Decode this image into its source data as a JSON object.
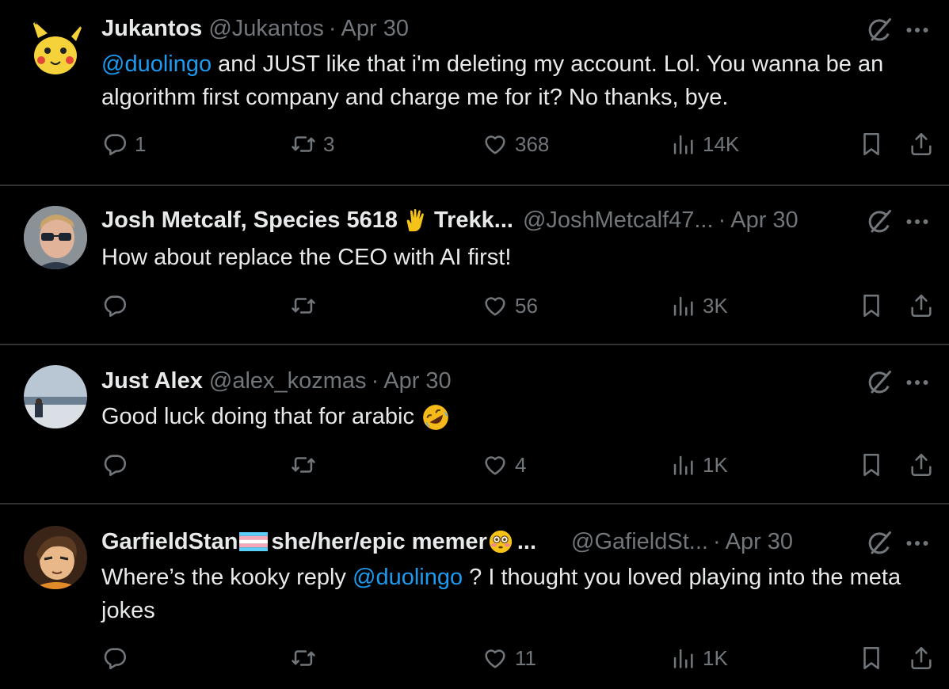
{
  "tweets": [
    {
      "name": "Jukantos",
      "handle": "@Jukantos",
      "separator": "·",
      "date": "Apr 30",
      "text_mention": "@duolingo",
      "text_after": " and JUST like that i'm deleting my account. Lol. You wanna be an algorithm first company and charge me for it? No thanks, bye.",
      "replies": "1",
      "reposts": "3",
      "likes": "368",
      "views": "14K"
    },
    {
      "name": "Josh Metcalf, Species 5618",
      "name_emoji": "vulcan-salute",
      "name_after": "Trekk...",
      "handle": "@JoshMetcalf47...",
      "separator": "·",
      "date": "Apr 30",
      "text": "How about replace the CEO with AI first!",
      "replies": "",
      "reposts": "",
      "likes": "56",
      "views": "3K"
    },
    {
      "name": "Just Alex",
      "handle": "@alex_kozmas",
      "separator": "·",
      "date": "Apr 30",
      "text": "Good luck doing that for arabic",
      "text_emoji": "rolling-on-floor-laughing",
      "replies": "",
      "reposts": "",
      "likes": "4",
      "views": "1K"
    },
    {
      "name": "GarfieldStan",
      "name_flag": "transgender-flag",
      "name_after": "she/her/epic memer",
      "name_emoji": "flushed-face",
      "name_ellipsis": "...",
      "handle": "@GafieldSt...",
      "separator": "·",
      "date": "Apr 30",
      "text_before": "Where’s the kooky reply ",
      "text_mention": "@duolingo",
      "text_after": " ? I thought you loved playing into the meta jokes",
      "replies": "",
      "reposts": "",
      "likes": "11",
      "views": "1K"
    }
  ],
  "colors": {
    "background": "#000000",
    "text": "#e7e9ea",
    "muted": "#71767b",
    "mention": "#1d9bf0",
    "divider": "#2f3336"
  },
  "icons": [
    "reply-icon",
    "repost-icon",
    "like-icon",
    "views-icon",
    "bookmark-icon",
    "share-icon",
    "grok-icon",
    "more-icon"
  ]
}
